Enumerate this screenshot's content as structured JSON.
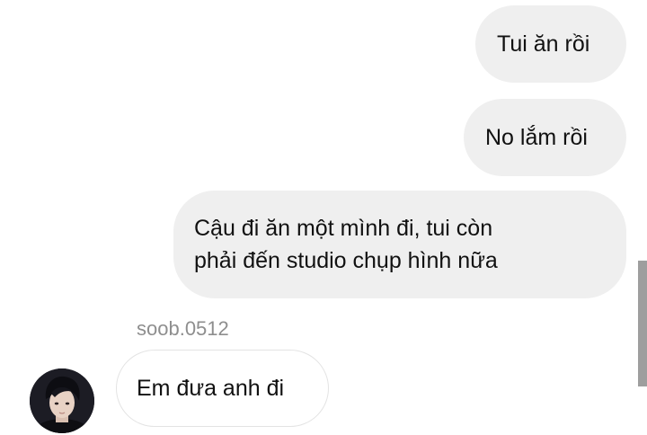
{
  "chat": {
    "messages": [
      {
        "direction": "sent",
        "text": "Tui ăn rồi"
      },
      {
        "direction": "sent",
        "text": "No lắm rồi"
      },
      {
        "direction": "sent",
        "lines": [
          "Cậu đi ăn một mình đi, tui còn",
          "phải đến studio chụp hình nữa"
        ]
      },
      {
        "direction": "received",
        "sender": "soob.0512",
        "text": "Em đưa anh đi"
      }
    ]
  },
  "colors": {
    "sent_bubble": "#efefef",
    "received_border": "#e3e3e3",
    "sender_name": "#8e8e8e",
    "text": "#111111",
    "scrollbar": "#9e9e9e"
  }
}
